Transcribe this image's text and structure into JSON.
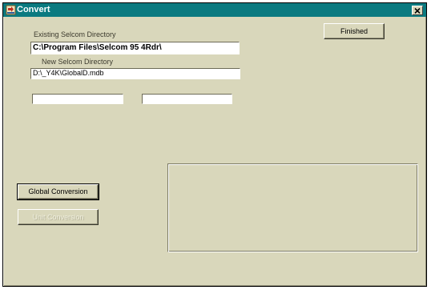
{
  "window": {
    "title": "Convert"
  },
  "existing_directory": {
    "label": "Existing Selcom Directory",
    "value": "C:\\Program Files\\Selcom 95 4Rdr\\"
  },
  "new_directory": {
    "label": "New Selcom Directory",
    "value": "D:\\_Y4K\\GlobalD.mdb"
  },
  "buttons": {
    "finished": "Finished",
    "global_conversion": "Global Conversion",
    "unit_conversion": "Unit Conversion"
  },
  "status_fields": {
    "left": "",
    "right": ""
  },
  "icons": {
    "app": "convert-app-icon",
    "close": "close-icon"
  },
  "colors": {
    "titlebar": "#0b7a80",
    "window_bg": "#d9d7bb"
  }
}
